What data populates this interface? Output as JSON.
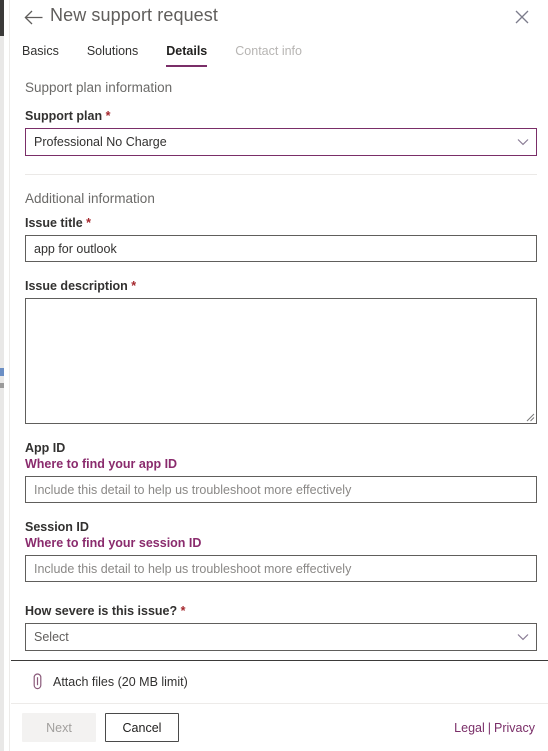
{
  "header": {
    "title": "New support request",
    "back_icon": "arrow-left-icon",
    "close_icon": "close-icon"
  },
  "tabs": [
    {
      "label": "Basics",
      "state": "enabled"
    },
    {
      "label": "Solutions",
      "state": "enabled"
    },
    {
      "label": "Details",
      "state": "active"
    },
    {
      "label": "Contact info",
      "state": "disabled"
    }
  ],
  "sections": {
    "support_plan": {
      "heading": "Support plan information",
      "plan_label": "Support plan",
      "plan_required": "*",
      "plan_value": "Professional No Charge",
      "chevron_icon": "chevron-down-icon"
    },
    "additional": {
      "heading": "Additional information",
      "issue_title_label": "Issue title",
      "issue_title_required": "*",
      "issue_title_value": "app for outlook",
      "issue_desc_label": "Issue description",
      "issue_desc_required": "*",
      "issue_desc_value": "",
      "app_id_label": "App ID",
      "app_id_link": "Where to find your app ID",
      "app_id_placeholder": "Include this detail to help us troubleshoot more effectively",
      "app_id_value": "",
      "session_id_label": "Session ID",
      "session_id_link": "Where to find your session ID",
      "session_id_placeholder": "Include this detail to help us troubleshoot more effectively",
      "session_id_value": "",
      "severity_label": "How severe is this issue?",
      "severity_required": "*",
      "severity_value": "Select",
      "severity_chevron_icon": "chevron-down-icon"
    }
  },
  "attach": {
    "icon": "paperclip-icon",
    "label": "Attach files (20 MB limit)"
  },
  "footer": {
    "next_label": "Next",
    "cancel_label": "Cancel",
    "legal_label": "Legal",
    "separator": "|",
    "privacy_label": "Privacy"
  },
  "colors": {
    "accent_purple": "#7a2e68",
    "link_purple": "#8a2b6d",
    "required_red": "#a4262c",
    "disabled_gray": "#b7b5b3"
  }
}
